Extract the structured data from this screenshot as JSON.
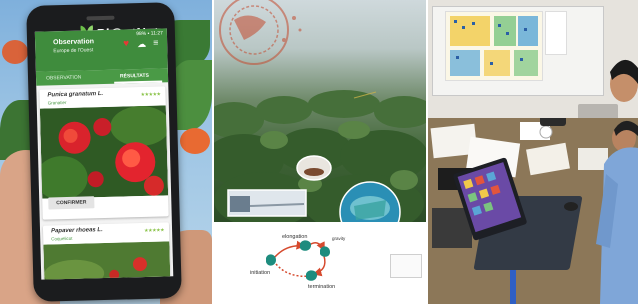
{
  "phone": {
    "brand": "Pl@ntNet",
    "status": "98% ▪ 11:27",
    "title": "Observation",
    "subtitle": "Europe de l'Ouest",
    "tab_observation": "OBSERVATION",
    "tab_results": "RÉSULTATS",
    "result_1": {
      "name": "Punica granatum L.",
      "family": "Granatier",
      "stars": "★★★★★"
    },
    "confirm_label": "CONFIRMER",
    "result_2": {
      "name": "Papaver rhoeas L.",
      "family": "Coquelicot",
      "stars": "★★★★★"
    }
  },
  "diagram": {
    "stages": [
      "elongation",
      "initiation",
      "termination"
    ],
    "partial_label": "gravity",
    "colors": {
      "node": "#1e8c7e",
      "arrow": "#d64a2e"
    }
  },
  "colors": {
    "plantnet_green": "#3f8c3d",
    "forest": "#3f6436"
  }
}
